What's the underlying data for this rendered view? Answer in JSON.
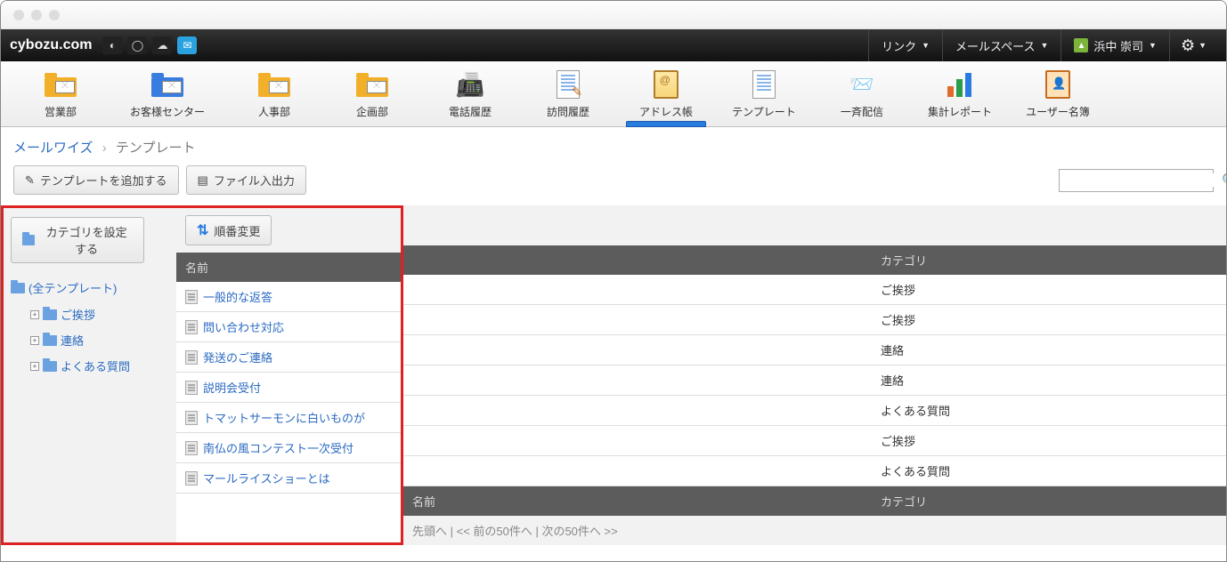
{
  "brand": "cybozu.com",
  "topmenu": {
    "links": "リンク",
    "mailspace": "メールスペース",
    "user": "浜中 崇司"
  },
  "appnav": [
    {
      "label": "営業部",
      "icon": "mail-folder",
      "color": "#f2b02a"
    },
    {
      "label": "お客様センター",
      "icon": "mail-folder",
      "color": "#3a7de0",
      "wider": true
    },
    {
      "label": "人事部",
      "icon": "mail-folder",
      "color": "#f2b02a"
    },
    {
      "label": "企画部",
      "icon": "mail-folder",
      "color": "#f2b02a"
    },
    {
      "label": "電話履歴",
      "icon": "phone"
    },
    {
      "label": "訪問履歴",
      "icon": "doc-pen"
    },
    {
      "label": "アドレス帳",
      "icon": "book-addr",
      "active": true
    },
    {
      "label": "テンプレート",
      "icon": "doc"
    },
    {
      "label": "一斉配信",
      "icon": "send"
    },
    {
      "label": "集計レポート",
      "icon": "bars"
    },
    {
      "label": "ユーザー名簿",
      "icon": "userbook"
    }
  ],
  "breadcrumb": {
    "root": "メールワイズ",
    "current": "テンプレート"
  },
  "toolbar": {
    "add_template": "テンプレートを追加する",
    "file_io": "ファイル入出力"
  },
  "sidebar": {
    "set_category": "カテゴリを設定する",
    "root": "(全テンプレート)",
    "children": [
      "ご挨拶",
      "連絡",
      "よくある質問"
    ]
  },
  "maintools": {
    "reorder": "順番変更"
  },
  "columns": {
    "name": "名前",
    "category": "カテゴリ"
  },
  "rows": [
    {
      "name": "一般的な返答",
      "category": "ご挨拶"
    },
    {
      "name": "問い合わせ対応",
      "category": "ご挨拶"
    },
    {
      "name": "発送のご連絡",
      "category": "連絡"
    },
    {
      "name": "説明会受付",
      "category": "連絡"
    },
    {
      "name": "トマットサーモンに白いものが",
      "category": "よくある質問"
    },
    {
      "name": "南仏の風コンテスト一次受付",
      "category": "ご挨拶"
    },
    {
      "name": "マールライスショーとは",
      "category": "よくある質問"
    }
  ],
  "pager": "先頭へ  |  << 前の50件へ  |  次の50件へ >>"
}
